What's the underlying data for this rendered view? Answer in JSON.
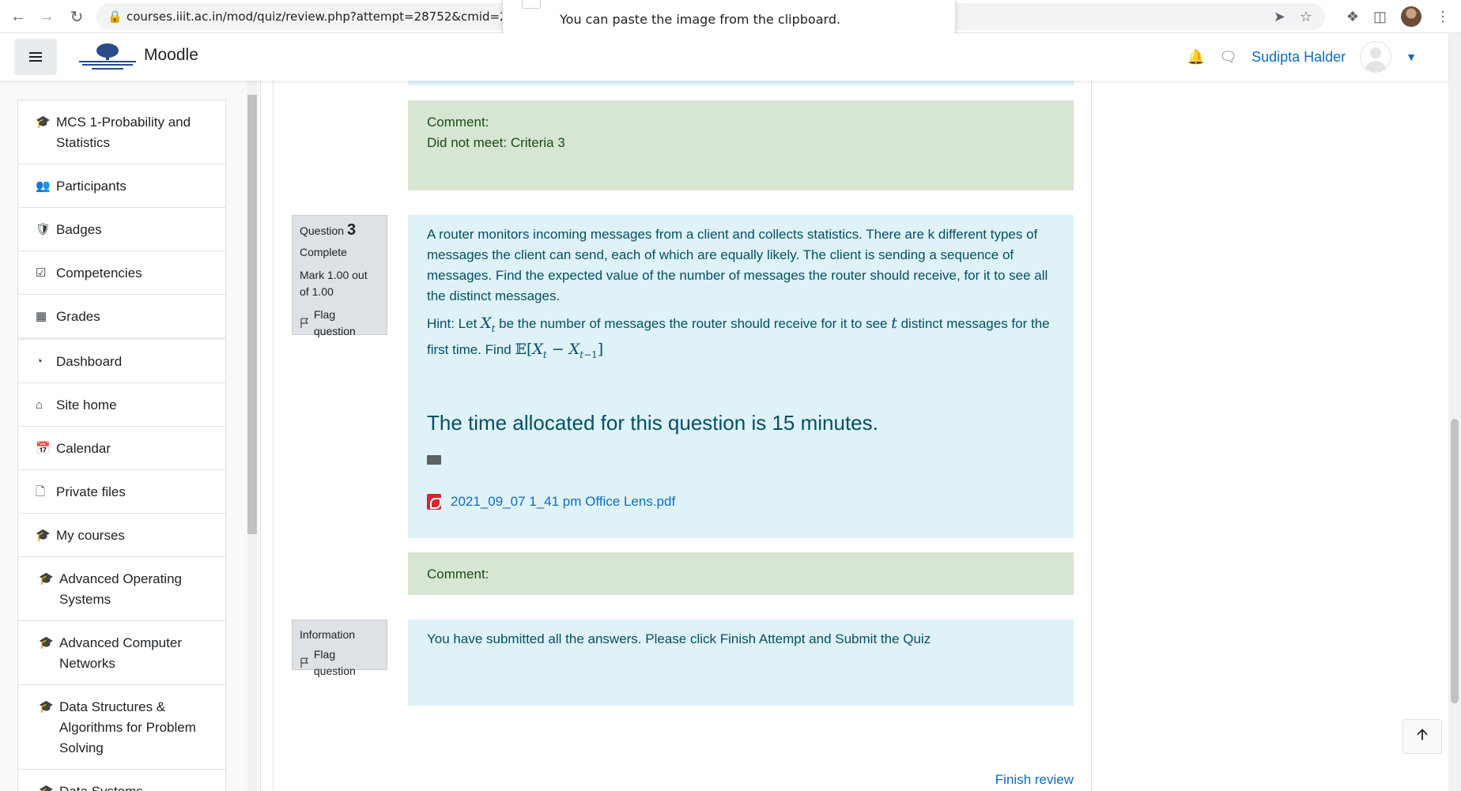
{
  "browser": {
    "url": "courses.iiit.ac.in/mod/quiz/review.php?attempt=28752&cmid=29",
    "toast_text": "You can paste the image from the clipboard."
  },
  "navbar": {
    "brand": "Moodle",
    "username": "Sudipta Halder"
  },
  "drawer": {
    "group1": [
      {
        "icon": "graduation-cap-icon",
        "label": "MCS 1-Probability and Statistics"
      },
      {
        "icon": "users-icon",
        "label": "Participants"
      },
      {
        "icon": "shield-icon",
        "label": "Badges"
      },
      {
        "icon": "check-square-icon",
        "label": "Competencies"
      },
      {
        "icon": "table-icon",
        "label": "Grades"
      }
    ],
    "group2": [
      {
        "icon": "dashboard-icon",
        "label": "Dashboard"
      },
      {
        "icon": "home-icon",
        "label": "Site home"
      },
      {
        "icon": "calendar-icon",
        "label": "Calendar"
      },
      {
        "icon": "file-icon",
        "label": "Private files"
      },
      {
        "icon": "graduation-cap-icon",
        "label": "My courses"
      },
      {
        "icon": "graduation-cap-icon",
        "label": "Advanced Operating Systems"
      },
      {
        "icon": "graduation-cap-icon",
        "label": "Advanced Computer Networks"
      },
      {
        "icon": "graduation-cap-icon",
        "label": "Data Structures & Algorithms for Problem Solving"
      },
      {
        "icon": "graduation-cap-icon",
        "label": "Data Systems"
      }
    ]
  },
  "comment1": {
    "label": "Comment:",
    "text": "Did not meet: Criteria 3"
  },
  "question3": {
    "label": "Question",
    "number": "3",
    "state": "Complete",
    "mark": "Mark 1.00 out of 1.00",
    "flag": "Flag question",
    "text": "A router monitors incoming messages from a client and collects statistics. There are k different types of messages the client can send, each of which are equally likely. The client is sending a sequence of messages. Find the expected value of the number of messages the router should receive, for it to see all the distinct messages.",
    "hint_a": "Hint: Let ",
    "hint_b": " be the number of messages the router should receive for it to see ",
    "hint_c": " distinct messages for the first time. Find ",
    "time_note": "The time allocated for this question is 15 minutes.",
    "attachment": "2021_09_07 1_41 pm Office Lens.pdf"
  },
  "comment2": {
    "label": "Comment:"
  },
  "information": {
    "label": "Information",
    "flag": "Flag question",
    "text": "You have submitted all the answers. Please click Finish Attempt and Submit the Quiz"
  },
  "footer": {
    "finish_review": "Finish review"
  }
}
